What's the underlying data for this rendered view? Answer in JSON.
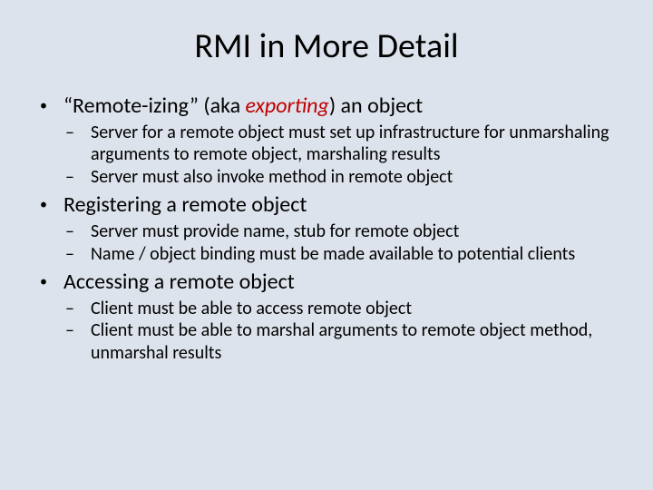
{
  "title": "RMI in More Detail",
  "bullets": [
    {
      "prefix": "“Remote-izing” (aka ",
      "emph": "exporting",
      "suffix": ") an object",
      "subs": [
        "Server for a remote object must set up infrastructure for unmarshaling arguments to remote object, marshaling results",
        "Server must also invoke method in remote object"
      ]
    },
    {
      "text": "Registering a remote object",
      "subs": [
        "Server must provide name, stub for remote object",
        "Name / object binding must be made available to potential clients"
      ]
    },
    {
      "text": "Accessing a remote object",
      "subs": [
        "Client must be able to access remote object",
        "Client must be able to marshal arguments to remote object method, unmarshal results"
      ]
    }
  ]
}
